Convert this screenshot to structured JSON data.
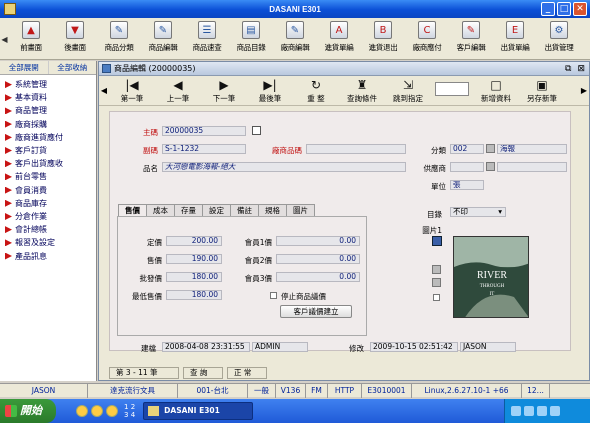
{
  "window": {
    "title": "DASANI E301"
  },
  "toolbar": {
    "items": [
      {
        "label": "前畫面",
        "icon": "arrow-up-icon",
        "glyph": "▲"
      },
      {
        "label": "後畫面",
        "icon": "arrow-down-icon",
        "glyph": "▼"
      },
      {
        "label": "商品分類",
        "icon": "edit-icon",
        "glyph": "✎"
      },
      {
        "label": "商品編輯",
        "icon": "edit-icon",
        "glyph": "✎"
      },
      {
        "label": "商品速查",
        "icon": "list-icon",
        "glyph": "☰"
      },
      {
        "label": "商品目錄",
        "icon": "catalog-icon",
        "glyph": "▤"
      },
      {
        "label": "廠商編輯",
        "icon": "edit-icon",
        "glyph": "✎"
      },
      {
        "label": "進貨單編",
        "icon": "doc-a-icon",
        "glyph": "A"
      },
      {
        "label": "進貨退出",
        "icon": "doc-b-icon",
        "glyph": "B"
      },
      {
        "label": "廠商應付",
        "icon": "doc-c-icon",
        "glyph": "C"
      },
      {
        "label": "客戶編輯",
        "icon": "edit-icon",
        "glyph": "✎"
      },
      {
        "label": "出貨單編",
        "icon": "doc-e-icon",
        "glyph": "E"
      },
      {
        "label": "出貨管理",
        "icon": "gear-icon",
        "glyph": "⚙"
      }
    ]
  },
  "sidebar": {
    "tabs": [
      "全部展開",
      "全部收納"
    ],
    "items": [
      "系統管理",
      "基本資料",
      "商品管理",
      "廠商採購",
      "廠商進貨應付",
      "客戶訂貨",
      "客戶出貨應收",
      "前台零售",
      "會員消費",
      "商品庫存",
      "分倉作業",
      "會計總帳",
      "報習及設定",
      "產品訊息"
    ]
  },
  "subwindow": {
    "title": "商品編輯 (20000035)",
    "nav": [
      {
        "label": "第一筆",
        "glyph": "|◀"
      },
      {
        "label": "上一筆",
        "glyph": "◀"
      },
      {
        "label": "下一筆",
        "glyph": "▶"
      },
      {
        "label": "最後筆",
        "glyph": "▶|"
      },
      {
        "label": "重 整",
        "glyph": "↻"
      },
      {
        "label": "查詢條件",
        "glyph": "♜"
      },
      {
        "label": "跳到指定",
        "glyph": "⇲"
      },
      {
        "label": "新增資料",
        "glyph": "□"
      },
      {
        "label": "另存新筆",
        "glyph": "▣"
      }
    ]
  },
  "form": {
    "main_code_label": "主碼",
    "main_code": "20000035",
    "sub_code_label": "副碼",
    "sub_code": "S-1-1232",
    "vendor_code_label": "廠商品碼",
    "vendor_code": "",
    "name_label": "品名",
    "name": "大河戀電影海報-絕大",
    "category_label": "分類",
    "category_code": "002",
    "category_name": "海報",
    "supplier_label": "供應商",
    "supplier": "",
    "unit_label": "單位",
    "unit": "張",
    "catalog_label": "目錄",
    "catalog_value": "不印",
    "image_label": "圖片1",
    "image_text": [
      "RIVER",
      "THROUGH",
      "IT"
    ]
  },
  "tabs": [
    "售價",
    "成本",
    "存量",
    "設定",
    "備註",
    "規格",
    "圖片"
  ],
  "pricing": {
    "list_label": "定價",
    "list": "200.00",
    "sale_label": "售價",
    "sale": "190.00",
    "wholesale_label": "批發價",
    "wholesale": "180.00",
    "min_label": "最低售價",
    "min": "180.00",
    "m1_label": "會員1價",
    "m1": "0.00",
    "m2_label": "會員2價",
    "m2": "0.00",
    "m3_label": "會員3價",
    "m3": "0.00",
    "stop_label": "停止商品議價",
    "customer_price_btn": "客戶議價建立"
  },
  "audit": {
    "created_label": "建檔",
    "created": "2008-04-08 23:31:55",
    "created_by": "ADMIN",
    "modified_label": "修改",
    "modified": "2009-10-15 02:51:42",
    "modified_by": "JASON"
  },
  "recordbar": [
    "第 3 - 11 筆",
    "查 詢",
    "正 常"
  ],
  "appstatus": [
    "JASON",
    "達克流行文具",
    "001-台北",
    "一般",
    "V136",
    "FM",
    "HTTP",
    "E3010001",
    "Linux,2.6.27.10-1 +66",
    "12..."
  ],
  "taskbar": {
    "start": "開始",
    "pager": [
      "1",
      "2",
      "3",
      "4"
    ],
    "task": "DASANI E301"
  }
}
